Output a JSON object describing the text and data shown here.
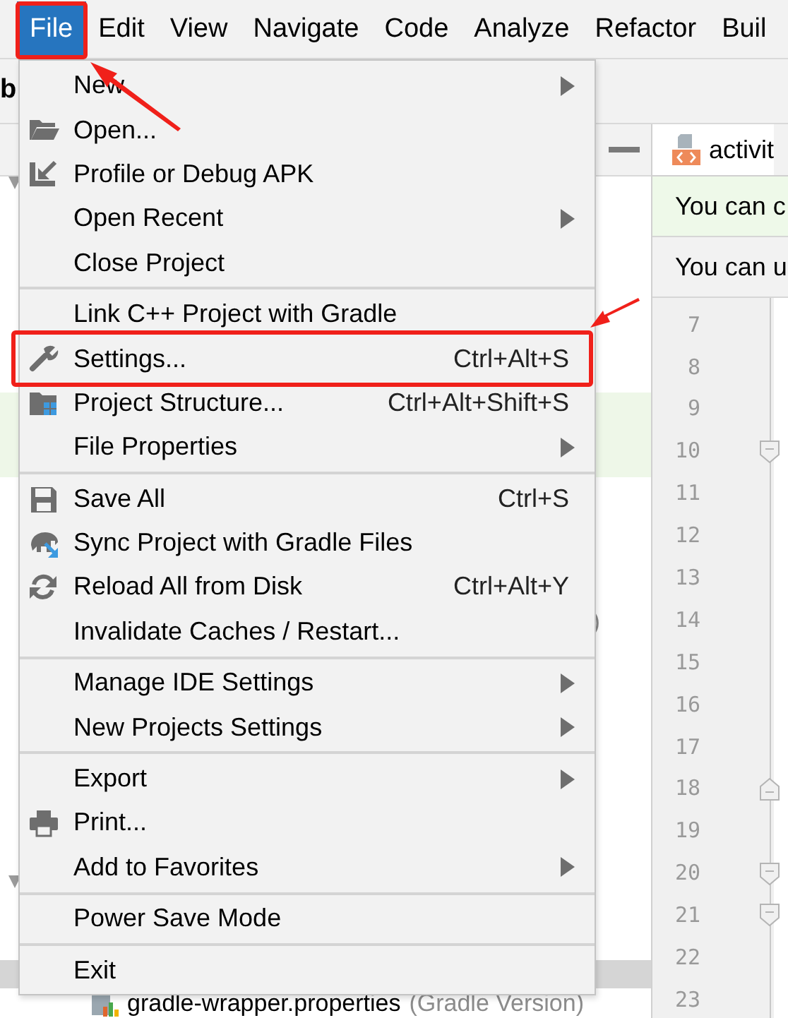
{
  "menubar": [
    {
      "label": "File",
      "selected": true,
      "annotated": true
    },
    {
      "label": "Edit",
      "selected": false,
      "annotated": false
    },
    {
      "label": "View",
      "selected": false,
      "annotated": false
    },
    {
      "label": "Navigate",
      "selected": false,
      "annotated": false
    },
    {
      "label": "Code",
      "selected": false,
      "annotated": false
    },
    {
      "label": "Analyze",
      "selected": false,
      "annotated": false
    },
    {
      "label": "Refactor",
      "selected": false,
      "annotated": false
    },
    {
      "label": "Buil",
      "selected": false,
      "annotated": false
    }
  ],
  "toolbar": {
    "label": "b"
  },
  "file_menu": [
    {
      "kind": "item",
      "label": "New",
      "submenu": true
    },
    {
      "kind": "item",
      "label": "Open..."
    },
    {
      "kind": "item",
      "label": "Profile or Debug APK"
    },
    {
      "kind": "item",
      "label": "Open Recent",
      "submenu": true
    },
    {
      "kind": "item",
      "label": "Close Project"
    },
    {
      "kind": "separator"
    },
    {
      "kind": "item",
      "label": "Link C++ Project with Gradle"
    },
    {
      "kind": "item",
      "label": "Settings...",
      "shortcut": "Ctrl+Alt+S",
      "annotated": true
    },
    {
      "kind": "item",
      "label": "Project Structure...",
      "shortcut": "Ctrl+Alt+Shift+S"
    },
    {
      "kind": "item",
      "label": "File Properties",
      "submenu": true
    },
    {
      "kind": "separator"
    },
    {
      "kind": "item",
      "label": "Save All",
      "shortcut": "Ctrl+S"
    },
    {
      "kind": "item",
      "label": "Sync Project with Gradle Files"
    },
    {
      "kind": "item",
      "label": "Reload All from Disk",
      "shortcut": "Ctrl+Alt+Y"
    },
    {
      "kind": "item",
      "label": "Invalidate Caches / Restart..."
    },
    {
      "kind": "separator"
    },
    {
      "kind": "item",
      "label": "Manage IDE Settings",
      "submenu": true
    },
    {
      "kind": "item",
      "label": "New Projects Settings",
      "submenu": true
    },
    {
      "kind": "separator"
    },
    {
      "kind": "item",
      "label": "Export",
      "submenu": true
    },
    {
      "kind": "item",
      "label": "Print..."
    },
    {
      "kind": "item",
      "label": "Add to Favorites",
      "submenu": true
    },
    {
      "kind": "separator"
    },
    {
      "kind": "item",
      "label": "Power Save Mode"
    },
    {
      "kind": "separator"
    },
    {
      "kind": "item",
      "label": "Exit"
    }
  ],
  "project_panel": {
    "tree_fragment": ")",
    "bottom_row": {
      "label": "gradle-wrapper.properties",
      "note": "(Gradle Version)"
    }
  },
  "editor": {
    "tab": {
      "label": "activit",
      "selected": true
    },
    "notices": [
      {
        "text": "You can c",
        "kind": "success"
      },
      {
        "text": "You can u",
        "kind": "info"
      }
    ],
    "lines": [
      {
        "number": "7",
        "kind": "plain"
      },
      {
        "number": "8",
        "kind": "plain"
      },
      {
        "number": "9",
        "kind": "plain"
      },
      {
        "number": "10",
        "kind": "fold-start"
      },
      {
        "number": "11",
        "kind": "plain"
      },
      {
        "number": "12",
        "kind": "plain"
      },
      {
        "number": "13",
        "kind": "plain"
      },
      {
        "number": "14",
        "kind": "plain"
      },
      {
        "number": "15",
        "kind": "plain"
      },
      {
        "number": "16",
        "kind": "plain"
      },
      {
        "number": "17",
        "kind": "plain"
      },
      {
        "number": "18",
        "kind": "fold-end"
      },
      {
        "number": "19",
        "kind": "plain"
      },
      {
        "number": "20",
        "kind": "fold-start"
      },
      {
        "number": "21",
        "kind": "fold-start"
      },
      {
        "number": "22",
        "kind": "plain"
      },
      {
        "number": "23",
        "kind": "plain"
      }
    ]
  }
}
